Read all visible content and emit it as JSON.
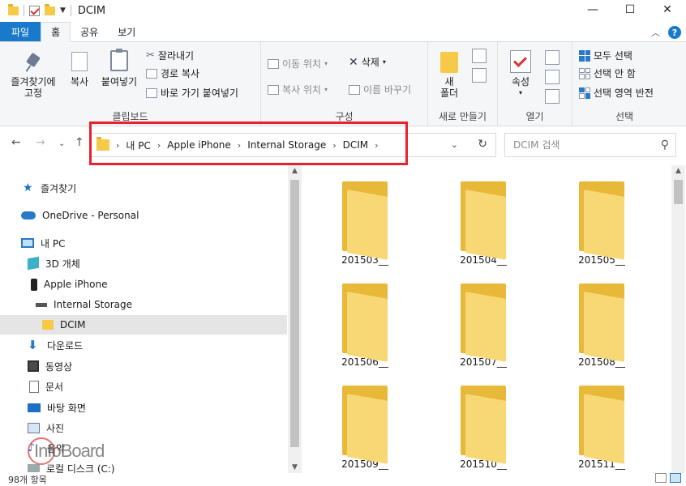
{
  "window": {
    "title": "DCIM",
    "minimize": "—",
    "maximize": "☐",
    "close": "✕"
  },
  "ribbon_tabs": [
    "파일",
    "홈",
    "공유",
    "보기"
  ],
  "ribbon": {
    "clipboard": {
      "pin": "즐겨찾기에\n고정",
      "copy": "복사",
      "paste": "붙여넣기",
      "cut": "잘라내기",
      "copy_path": "경로 복사",
      "paste_shortcut": "바로 가기 붙여넣기",
      "label": "클립보드"
    },
    "organize": {
      "move_to": "이동 위치",
      "copy_to": "복사 위치",
      "delete": "삭제",
      "rename": "이름 바꾸기",
      "label": "구성"
    },
    "new": {
      "new_folder": "새\n폴더",
      "label": "새로 만들기"
    },
    "open": {
      "properties": "속성",
      "label": "열기"
    },
    "select": {
      "select_all": "모두 선택",
      "select_none": "선택 안 함",
      "invert": "선택 영역 반전",
      "label": "선택"
    }
  },
  "address": {
    "crumbs": [
      "내 PC",
      "Apple iPhone",
      "Internal Storage",
      "DCIM"
    ]
  },
  "search": {
    "placeholder": "DCIM 검색"
  },
  "nav": [
    {
      "label": "즐겨찾기",
      "icon": "star-icon"
    },
    {
      "label": "OneDrive - Personal",
      "icon": "cloud-icon"
    },
    {
      "label": "내 PC",
      "icon": "computer-icon"
    },
    {
      "label": "3D 개체",
      "icon": "cube-icon"
    },
    {
      "label": "Apple iPhone",
      "icon": "phone-icon"
    },
    {
      "label": "Internal Storage",
      "icon": "drive-icon"
    },
    {
      "label": "DCIM",
      "icon": "folder-icon"
    },
    {
      "label": "다운로드",
      "icon": "download-icon"
    },
    {
      "label": "동영상",
      "icon": "video-icon"
    },
    {
      "label": "문서",
      "icon": "document-icon"
    },
    {
      "label": "바탕 화면",
      "icon": "desktop-icon"
    },
    {
      "label": "사진",
      "icon": "picture-icon"
    },
    {
      "label": "음악",
      "icon": "music-icon"
    },
    {
      "label": "로컬 디스크 (C:)",
      "icon": "disk-icon"
    }
  ],
  "folders": [
    "201503__",
    "201504__",
    "201505__",
    "201506__",
    "201507__",
    "201508__",
    "201509__",
    "201510__",
    "201511__"
  ],
  "status": {
    "count": "98개 항목"
  },
  "watermark": "InfoBoard",
  "colors": {
    "accent": "#1979ca",
    "highlight": "#e5222e",
    "folder": "#f8d775"
  }
}
